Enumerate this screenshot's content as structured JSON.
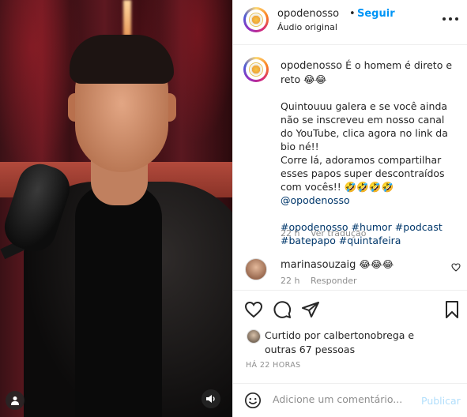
{
  "post": {
    "username": "opodenosso",
    "separator": "•",
    "follow_label": "Seguir",
    "audio_label": "Áudio original",
    "more_icon": "more-horizontal-icon"
  },
  "caption": {
    "username": "opodenosso",
    "line1": "É o homem é direto e reto 😂😂",
    "para2": "Quintouuu galera e se você ainda não se inscreveu em nosso canal do YouTube, clica agora no link da bio né!!",
    "para3": "Corre lá, adoramos compartilhar esses papos super descontraídos com vocês!! 🤣🤣🤣🤣",
    "mention": "@opodenosso",
    "hashtags_line1": "#opodenosso #humor #podcast",
    "hashtags_line2": "#batepapo #quintafeira",
    "time": "22 h",
    "see_translation": "Ver tradução"
  },
  "comment": {
    "username": "marinasouzaig",
    "text": "😂😂😂",
    "time": "22 h",
    "reply": "Responder"
  },
  "likes": {
    "prefix": "Curtido por",
    "user": "calbertonobrega",
    "conj": "e",
    "others": "outras 67 pessoas"
  },
  "timestamp": "HÁ 22 HORAS",
  "add_comment": {
    "placeholder": "Adicione um comentário...",
    "publish": "Publicar"
  },
  "colors": {
    "accent": "#0095f6",
    "link": "#00376b",
    "muted": "#8e8e8e",
    "publish_disabled": "#b2dffc"
  }
}
